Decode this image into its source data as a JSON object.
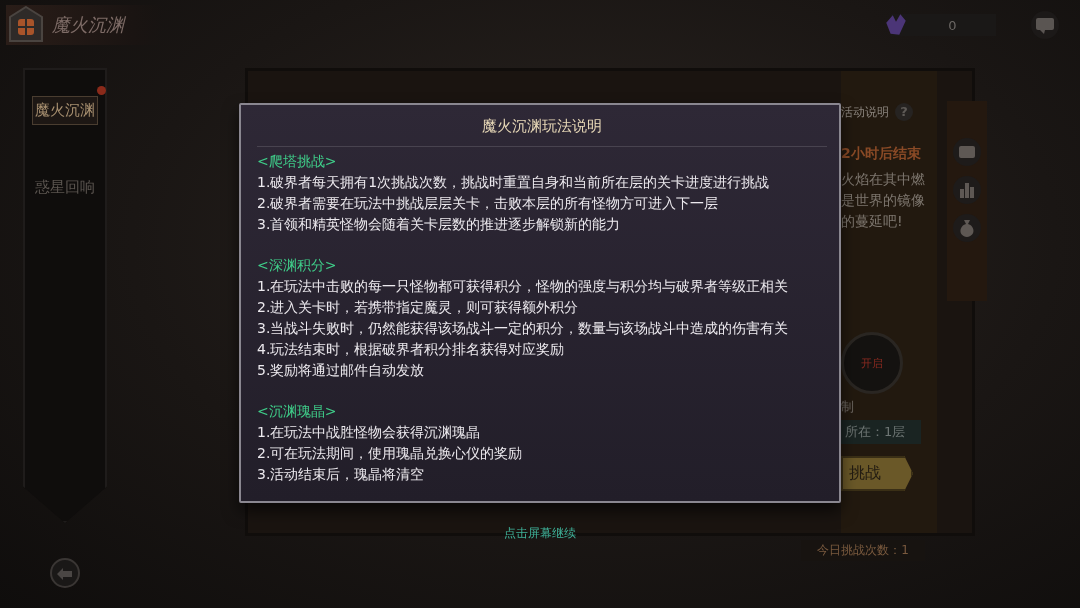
{
  "header": {
    "title": "魔火沉渊"
  },
  "currency": {
    "amount": "0"
  },
  "sidebar": {
    "tabs": [
      {
        "label": "魔火沉渊",
        "selected": true,
        "badge": true
      },
      {
        "label": "惑星回响",
        "selected": false,
        "badge": false
      }
    ]
  },
  "event_panel": {
    "help_label": "活动说明",
    "help_icon": "?",
    "countdown": "2小时后结束",
    "description": [
      "火焰在其中燃",
      "是世界的镜像",
      "的蔓延吧!"
    ],
    "boss_status": "开启",
    "boss_caption": "制",
    "current_floor": "所在：1层",
    "challenge_button": "挑战",
    "daily_attempts": "今日挑战次数：1"
  },
  "dialog": {
    "title": "魔火沉渊玩法说明",
    "sections": [
      {
        "heading": "<爬塔挑战>",
        "lines": [
          "1.破界者每天拥有1次挑战次数，挑战时重置自身和当前所在层的关卡进度进行挑战",
          "2.破界者需要在玩法中挑战层层关卡，击败本层的所有怪物方可进入下一层",
          "3.首领和精英怪物会随着关卡层数的推进逐步解锁新的能力"
        ]
      },
      {
        "heading": "<深渊积分>",
        "lines": [
          "1.在玩法中击败的每一只怪物都可获得积分，怪物的强度与积分均与破界者等级正相关",
          "2.进入关卡时，若携带指定魔灵，则可获得额外积分",
          "3.当战斗失败时，仍然能获得该场战斗一定的积分，数量与该场战斗中造成的伤害有关",
          "4.玩法结束时，根据破界者积分排名获得对应奖励",
          "5.奖励将通过邮件自动发放"
        ]
      },
      {
        "heading": "<沉渊瑰晶>",
        "lines": [
          "1.在玩法中战胜怪物会获得沉渊瑰晶",
          "2.可在玩法期间，使用瑰晶兑换心仪的奖励",
          "3.活动结束后，瑰晶将清空"
        ]
      }
    ],
    "footer": "点击屏幕继续"
  }
}
